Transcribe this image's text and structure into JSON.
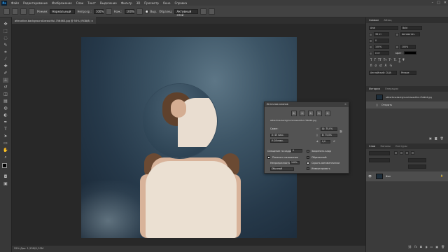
{
  "menubar": {
    "logo": "Ps",
    "items": [
      "Файл",
      "Редактирование",
      "Изображение",
      "Слои",
      "Текст",
      "Выделение",
      "Фильтр",
      "3D",
      "Просмотр",
      "Окно",
      "Справка"
    ],
    "window_controls": [
      "–",
      "□",
      "✕"
    ]
  },
  "options": {
    "mode_label": "Режим:",
    "mode_value": "Нормальный",
    "opacity_label": "Непрозр.:",
    "opacity_value": "100%",
    "flow_label": "Наж.:",
    "flow_value": "100%",
    "aligned_label": "Выр.",
    "sample_label": "Образец:",
    "sample_value": "Активный слой"
  },
  "document_tab": "attractive-background-beautiful-756463.jpg @ 55% (RGB/8)",
  "status_bar": "55%      Док: 1,53M/1,53M",
  "right_panel": {
    "character_header": [
      "Символ",
      "Абзац"
    ],
    "history_header": [
      "История",
      "Операции"
    ],
    "history_items": [
      "attractive-background-beautiful-756463.jpg",
      "Открыть"
    ],
    "layers_header": [
      "Слои",
      "Каналы",
      "Контуры"
    ],
    "layer_name": "Фон",
    "char_values": [
      "Arial",
      "Bold",
      "36 пт",
      "Автоматич.",
      "0",
      "100%",
      "100%",
      "0 пт",
      "Цвет:",
      "Английский: США",
      "Резкое"
    ]
  },
  "clone_panel": {
    "title": "Источник клонов",
    "close": "✕",
    "filename": "attractive-background-beautiful-756463.jpg",
    "offset_label": "Сдвиг:",
    "x_value": "X: 45 пикс.",
    "y_value": "Y: 28 пикс.",
    "w_value": "Ш: 75,0%",
    "h_value": "В: 75,0%",
    "angle_value": "0,0",
    "frame_offset_label": "Смещение по кадрам:",
    "frame_offset_value": "0",
    "lock_frame": "Закрепить кадр",
    "show_overlay": "Показать наложение",
    "opacity_label": "Непрозрачность:",
    "opacity_value": "100%",
    "clipped": "Обрезанный",
    "auto_hide": "Скрыть автоматически",
    "mode_value": "Обычный",
    "invert": "Инвертировать"
  }
}
